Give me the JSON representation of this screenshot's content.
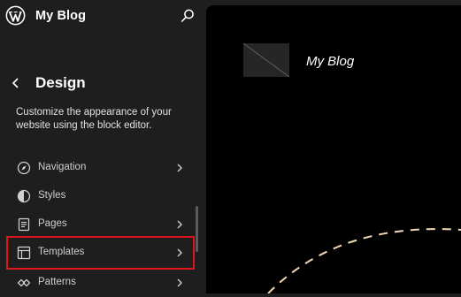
{
  "site": {
    "title": "My Blog",
    "logo_icon": "wordpress-logo-icon"
  },
  "header": {
    "search_icon": "search-icon"
  },
  "panel": {
    "back_icon": "chevron-left-icon",
    "title": "Design",
    "description": "Customize the appearance of your website using the block editor."
  },
  "nav": {
    "items": [
      {
        "label": "Navigation",
        "icon": "navigation-compass-icon",
        "has_chevron": true
      },
      {
        "label": "Styles",
        "icon": "styles-half-circle-icon",
        "has_chevron": false
      },
      {
        "label": "Pages",
        "icon": "pages-document-icon",
        "has_chevron": true
      },
      {
        "label": "Templates",
        "icon": "templates-layout-icon",
        "has_chevron": true,
        "highlighted": true
      },
      {
        "label": "Patterns",
        "icon": "patterns-diamond-icon",
        "has_chevron": true
      }
    ]
  },
  "preview": {
    "site_title": "My Blog"
  },
  "colors": {
    "sidebar_bg": "#1e1e1e",
    "preview_bg": "#000000",
    "highlight_outline": "#e0141e",
    "arc_dash": "#f2d9b8"
  }
}
